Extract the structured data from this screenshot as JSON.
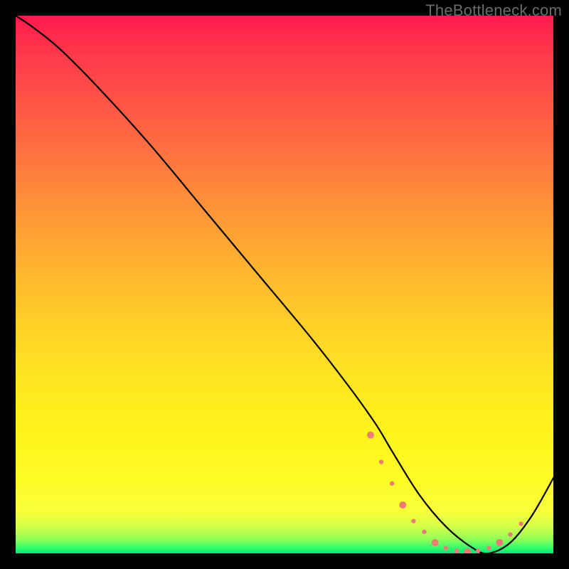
{
  "watermark": "TheBottleneck.com",
  "chart_data": {
    "type": "line",
    "title": "",
    "xlabel": "",
    "ylabel": "",
    "xlim": [
      0,
      100
    ],
    "ylim": [
      0,
      100
    ],
    "grid": false,
    "series": [
      {
        "name": "curve",
        "color": "#000000",
        "x": [
          0,
          3,
          8,
          15,
          25,
          35,
          45,
          55,
          62,
          67,
          70,
          75,
          80,
          85,
          88,
          92,
          96,
          100
        ],
        "y": [
          100,
          98,
          94,
          87,
          76,
          64,
          52,
          40,
          31,
          24,
          19,
          11,
          5,
          1,
          0,
          2,
          7,
          14
        ]
      }
    ],
    "marker_region": {
      "comment": "dotted salmon markers hugging valley",
      "color": "#ef7b78",
      "x": [
        66,
        68,
        70,
        72,
        74,
        76,
        78,
        80,
        82,
        84,
        86,
        88,
        90,
        92,
        94
      ],
      "y": [
        22,
        17,
        13,
        9,
        6,
        4,
        2,
        1,
        0.5,
        0.3,
        0.5,
        1,
        2,
        3.5,
        5.5
      ]
    },
    "background_gradient": {
      "stops": [
        {
          "pct": 0,
          "color": "#ff1a4d"
        },
        {
          "pct": 50,
          "color": "#ffd126"
        },
        {
          "pct": 92,
          "color": "#f8ff3a"
        },
        {
          "pct": 100,
          "color": "#00e676"
        }
      ]
    }
  }
}
